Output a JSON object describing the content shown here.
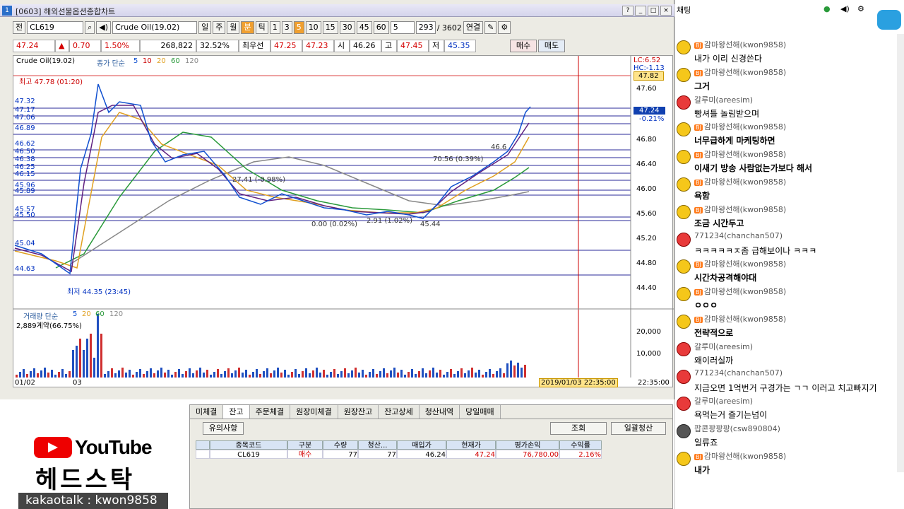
{
  "window": {
    "title": "[0603] 해외선물옵션종합차트",
    "icon": "1"
  },
  "toolbar": {
    "jeon": "전",
    "symbol": "CL619",
    "name": "Crude Oil(19.02)",
    "periods": [
      "일",
      "주",
      "월",
      "분",
      "틱"
    ],
    "intervals": [
      "1",
      "3",
      "5",
      "10",
      "15",
      "30",
      "45",
      "60",
      "5"
    ],
    "count": "293",
    "total": "/ 3602",
    "link": "연결"
  },
  "quote": {
    "price": "47.24",
    "arrow": "▲",
    "change": "0.70",
    "pct": "1.50%",
    "volume": "268,822",
    "vol_pct": "32.52%",
    "best_label": "최우선",
    "bid": "47.25",
    "ask": "47.23",
    "open_label": "시",
    "open": "46.26",
    "high_label": "고",
    "high": "47.45",
    "low_label": "저",
    "low": "45.35",
    "buy": "매수",
    "sell": "매도"
  },
  "chart": {
    "legend": "Crude Oil(19.02)",
    "ma_label": "종가 단순",
    "ma_values": [
      "5",
      "10",
      "20",
      "60",
      "120"
    ],
    "lc": "LC:6.52",
    "hc": "HC:-1.13",
    "high_label": "최고 47.78 (01:20)",
    "low_label": "최저 44.35 (23:45)",
    "y_ticks": [
      "47.60",
      "47.20",
      "46.80",
      "46.40",
      "46.00",
      "45.60",
      "45.20",
      "44.80",
      "44.40"
    ],
    "left_prices": [
      "47.32",
      "47.17",
      "47.06",
      "46.89",
      "46.62",
      "46.50",
      "46.38",
      "46.25",
      "46.15",
      "45.96",
      "45.89",
      "45.57",
      "45.50",
      "45.04",
      "44.63"
    ],
    "cur_box": "47.82",
    "cur_price": "47.24",
    "cur_pct": "-0.21%",
    "annots": [
      "70.56 (0.39%)",
      "46.6",
      "27.41 (-0.98%)",
      "0.00 (0.02%)",
      "2.91 (1.02%)",
      "45.44"
    ],
    "vol_legend": "거래량 단순",
    "vol_ma": [
      "5",
      "20",
      "60",
      "120"
    ],
    "vol_note": "2,889계약(66.75%)",
    "vol_ticks": [
      "20,000",
      "10,000"
    ],
    "x_labels": [
      "01/02",
      "03"
    ],
    "time_box": "2019/01/03 22:35:00",
    "time_right": "22:35:00"
  },
  "bottom": {
    "tabs": [
      "미체결",
      "잔고",
      "주문체결",
      "원장미체결",
      "원장잔고",
      "잔고상세",
      "청산내역",
      "당일매매"
    ],
    "caution": "유의사항",
    "query": "조회",
    "liquidate": "일괄청산",
    "headers": [
      "종목코드",
      "구분",
      "수량",
      "청산...",
      "매입가",
      "현재가",
      "평가손익",
      "수익률"
    ],
    "row": [
      "CL619",
      "매수",
      "77",
      "77",
      "46.24",
      "47.24",
      "76,780.00",
      "2.16%"
    ]
  },
  "youtube": {
    "logo": "YouTube",
    "channel": "헤드스탁",
    "kakao": "kakaotalk : kwon9858"
  },
  "chat": {
    "header": "채팅",
    "messages": [
      {
        "nick": "감마왕선해(kwon9858)",
        "text": "내가 이리 신경쓴다",
        "bj": true,
        "face": "y",
        "bold": false
      },
      {
        "nick": "감마왕선해(kwon9858)",
        "text": "그거",
        "bj": true,
        "face": "y",
        "bold": true
      },
      {
        "nick": "갈루미(areesim)",
        "text": "빵셔틀 놀림받으며",
        "bj": false,
        "face": "r",
        "bold": false
      },
      {
        "nick": "감마왕선해(kwon9858)",
        "text": "너무급하게 마케팅하면",
        "bj": true,
        "face": "y",
        "bold": true
      },
      {
        "nick": "감마왕선해(kwon9858)",
        "text": "이새기 방송 사람없는가보다 해서",
        "bj": true,
        "face": "y",
        "bold": true
      },
      {
        "nick": "감마왕선해(kwon9858)",
        "text": "욕함",
        "bj": true,
        "face": "y",
        "bold": true
      },
      {
        "nick": "감마왕선해(kwon9858)",
        "text": "조금 시간두고",
        "bj": true,
        "face": "y",
        "bold": true
      },
      {
        "nick": "771234(chanchan507)",
        "text": "ㅋㅋㅋㅋㅋㅈ좀 급해보이나 ㅋㅋㅋ",
        "bj": false,
        "face": "r",
        "bold": false
      },
      {
        "nick": "감마왕선해(kwon9858)",
        "text": "시간차공격해야대",
        "bj": true,
        "face": "y",
        "bold": true
      },
      {
        "nick": "감마왕선해(kwon9858)",
        "text": "ㅇㅇㅇ",
        "bj": true,
        "face": "y",
        "bold": true
      },
      {
        "nick": "감마왕선해(kwon9858)",
        "text": "전략적으로",
        "bj": true,
        "face": "y",
        "bold": true
      },
      {
        "nick": "갈루미(areesim)",
        "text": "왜이러실까",
        "bj": false,
        "face": "r",
        "bold": false
      },
      {
        "nick": "771234(chanchan507)",
        "text": "지금오면 1억번거 구경가는 ㄱㄱ 이러고 치고빠지기",
        "bj": false,
        "face": "r",
        "bold": false
      },
      {
        "nick": "갈루미(areesim)",
        "text": "욕먹는거 즐기는넘이",
        "bj": false,
        "face": "r",
        "bold": false
      },
      {
        "nick": "팝콘팡팡팡(csw890804)",
        "text": "일류죠",
        "bj": false,
        "face": "g",
        "bold": false
      },
      {
        "nick": "감마왕선해(kwon9858)",
        "text": "내가",
        "bj": true,
        "face": "y",
        "bold": true
      }
    ]
  }
}
